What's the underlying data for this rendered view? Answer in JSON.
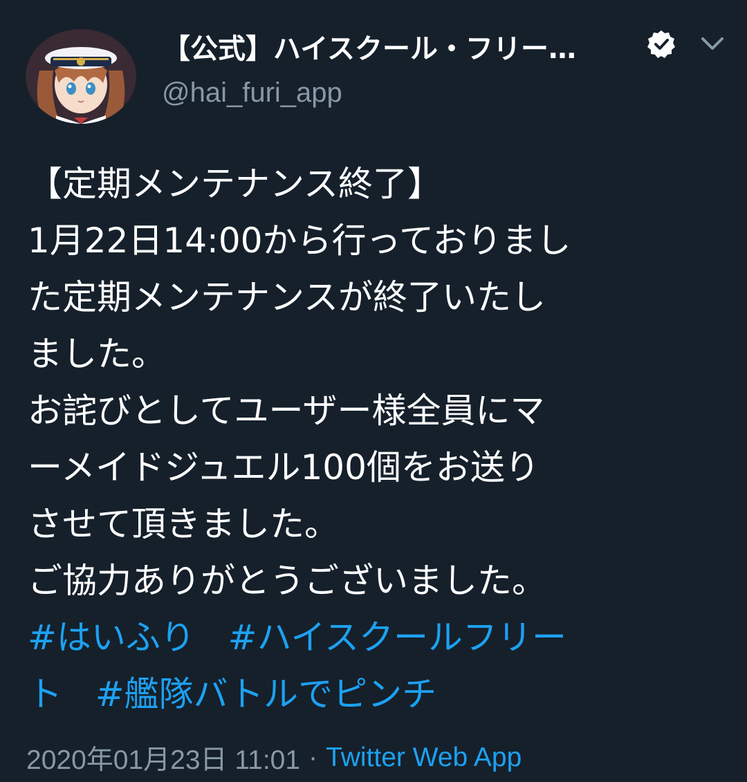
{
  "author": {
    "display_name": "【公式】ハイスクール・フリー…",
    "handle": "@hai_furi_app",
    "avatar_icon": "avatar-anime-captain",
    "verified_icon": "verified-badge-icon",
    "menu_icon": "chevron-down-icon"
  },
  "tweet": {
    "lines": [
      "【定期メンテナンス終了】",
      "1月22日14:00から行っておりまし",
      "た定期メンテナンスが終了いたし",
      "ました。",
      "お詫びとしてユーザー様全員にマ",
      "ーメイドジュエル100個をお送り",
      "させて頂きました。",
      "ご協力ありがとうございました。"
    ],
    "hashtag_lines": [
      [
        "#はいふり",
        "#ハイスクールフリー"
      ],
      [
        "ト",
        "#艦隊バトルでピンチ"
      ]
    ]
  },
  "meta": {
    "timestamp": "2020年01月23日 11:01",
    "separator": "·",
    "source": "Twitter Web App"
  },
  "colors": {
    "background": "#15202b",
    "text": "#ffffff",
    "secondary": "#8899a6",
    "accent": "#1da1f2"
  }
}
